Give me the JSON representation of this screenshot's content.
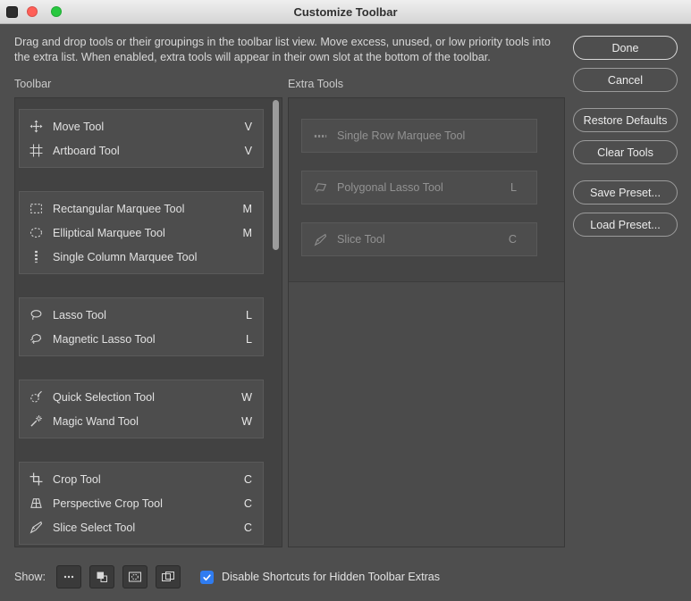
{
  "window": {
    "title": "Customize Toolbar"
  },
  "instructions": "Drag and drop tools or their groupings in the toolbar list view. Move excess, unused, or low priority tools into the extra list. When enabled, extra tools will appear in their own slot at the bottom of the toolbar.",
  "action_buttons": {
    "groups": [
      [
        {
          "label": "Done",
          "name": "done-button",
          "primary": true
        },
        {
          "label": "Cancel",
          "name": "cancel-button"
        }
      ],
      [
        {
          "label": "Restore Defaults",
          "name": "restore-defaults-button"
        },
        {
          "label": "Clear Tools",
          "name": "clear-tools-button"
        }
      ],
      [
        {
          "label": "Save Preset...",
          "name": "save-preset-button"
        },
        {
          "label": "Load Preset...",
          "name": "load-preset-button"
        }
      ]
    ]
  },
  "toolbar_section": {
    "label": "Toolbar",
    "groups": [
      {
        "items": [
          {
            "icon": "move-tool-icon",
            "label": "Move Tool",
            "shortcut": "V"
          },
          {
            "icon": "artboard-tool-icon",
            "label": "Artboard Tool",
            "shortcut": "V"
          }
        ]
      },
      {
        "items": [
          {
            "icon": "rectangular-marquee-icon",
            "label": "Rectangular Marquee Tool",
            "shortcut": "M"
          },
          {
            "icon": "elliptical-marquee-icon",
            "label": "Elliptical Marquee Tool",
            "shortcut": "M"
          },
          {
            "icon": "single-column-marquee-icon",
            "label": "Single Column Marquee Tool",
            "shortcut": ""
          }
        ]
      },
      {
        "items": [
          {
            "icon": "lasso-icon",
            "label": "Lasso Tool",
            "shortcut": "L"
          },
          {
            "icon": "magnetic-lasso-icon",
            "label": "Magnetic Lasso Tool",
            "shortcut": "L"
          }
        ]
      },
      {
        "items": [
          {
            "icon": "quick-selection-icon",
            "label": "Quick Selection Tool",
            "shortcut": "W"
          },
          {
            "icon": "magic-wand-icon",
            "label": "Magic Wand Tool",
            "shortcut": "W"
          }
        ]
      },
      {
        "items": [
          {
            "icon": "crop-icon",
            "label": "Crop Tool",
            "shortcut": "C"
          },
          {
            "icon": "perspective-crop-icon",
            "label": "Perspective Crop Tool",
            "shortcut": "C"
          },
          {
            "icon": "slice-select-icon",
            "label": "Slice Select Tool",
            "shortcut": "C"
          }
        ]
      }
    ]
  },
  "extra_section": {
    "label": "Extra Tools",
    "items": [
      {
        "icon": "single-row-marquee-icon",
        "label": "Single Row Marquee Tool",
        "shortcut": ""
      },
      {
        "icon": "polygonal-lasso-icon",
        "label": "Polygonal Lasso Tool",
        "shortcut": "L"
      },
      {
        "icon": "slice-tool-icon",
        "label": "Slice Tool",
        "shortcut": "C"
      }
    ]
  },
  "footer": {
    "show_label": "Show:",
    "show_buttons": [
      {
        "icon": "ellipsis-icon",
        "name": "toolbar-extras-toggle"
      },
      {
        "icon": "color-swatches-icon",
        "name": "color-controls-toggle"
      },
      {
        "icon": "quick-mask-icon",
        "name": "quick-mask-toggle"
      },
      {
        "icon": "screen-mode-icon",
        "name": "screen-mode-toggle"
      }
    ],
    "checkbox": {
      "checked": true,
      "label": "Disable Shortcuts for Hidden Toolbar Extras"
    }
  },
  "colors": {
    "accent_blue": "#2f7cf0",
    "traffic_red": "#ff5f57",
    "traffic_green": "#28c840",
    "dialog_bg": "#4e4e4e",
    "panel_bg": "#424242"
  }
}
